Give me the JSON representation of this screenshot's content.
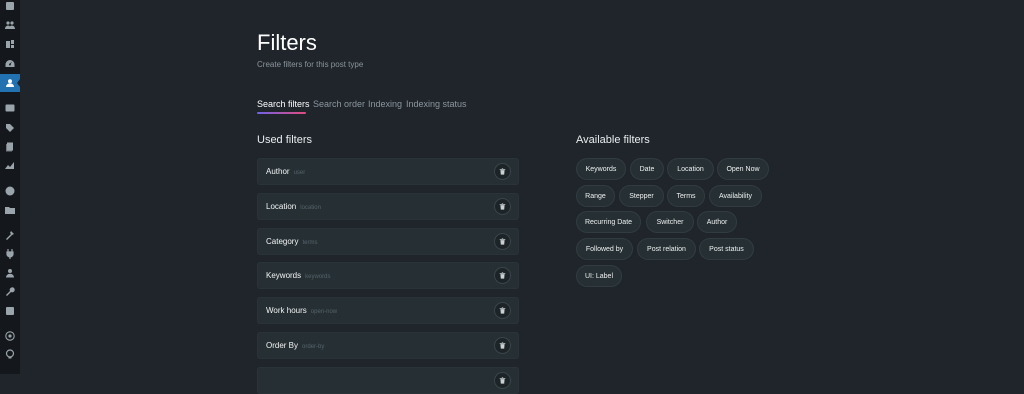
{
  "page": {
    "title": "Filters",
    "subtitle": "Create filters for this post type"
  },
  "tabs": [
    {
      "label": "Search filters",
      "active": true
    },
    {
      "label": "Search order",
      "active": false
    },
    {
      "label": "Indexing",
      "active": false
    },
    {
      "label": "Indexing status",
      "active": false
    }
  ],
  "used_filters": {
    "title": "Used filters",
    "items": [
      {
        "name": "Author",
        "key": "user"
      },
      {
        "name": "Location",
        "key": "location"
      },
      {
        "name": "Category",
        "key": "terms"
      },
      {
        "name": "Keywords",
        "key": "keywords"
      },
      {
        "name": "Work hours",
        "key": "open-now"
      },
      {
        "name": "Order By",
        "key": "order-by"
      }
    ]
  },
  "available_filters": {
    "title": "Available filters",
    "items": [
      "Keywords",
      "Date",
      "Location",
      "Open Now",
      "Range",
      "Stepper",
      "Terms",
      "Availability",
      "Recurring Date",
      "Switcher",
      "Author",
      "Followed by",
      "Post relation",
      "Post status",
      "UI: Label"
    ]
  },
  "sidebar_icons": [
    "dashboard-icon",
    "users-icon",
    "plugins-icon",
    "speedometer-icon",
    "profile-icon",
    "listings-icon",
    "tags-icon",
    "pages-icon",
    "chart-icon",
    "globe-icon",
    "folder-icon",
    "tools-icon",
    "plug-icon",
    "user-icon",
    "wrench-icon",
    "settings-icon",
    "at-icon",
    "support-icon"
  ],
  "colors": {
    "background": "#1f252b",
    "sidebar": "#14181c",
    "accent": "#2271b1",
    "tab_gradient_start": "#6f62e6",
    "tab_gradient_end": "#e24b7d"
  }
}
